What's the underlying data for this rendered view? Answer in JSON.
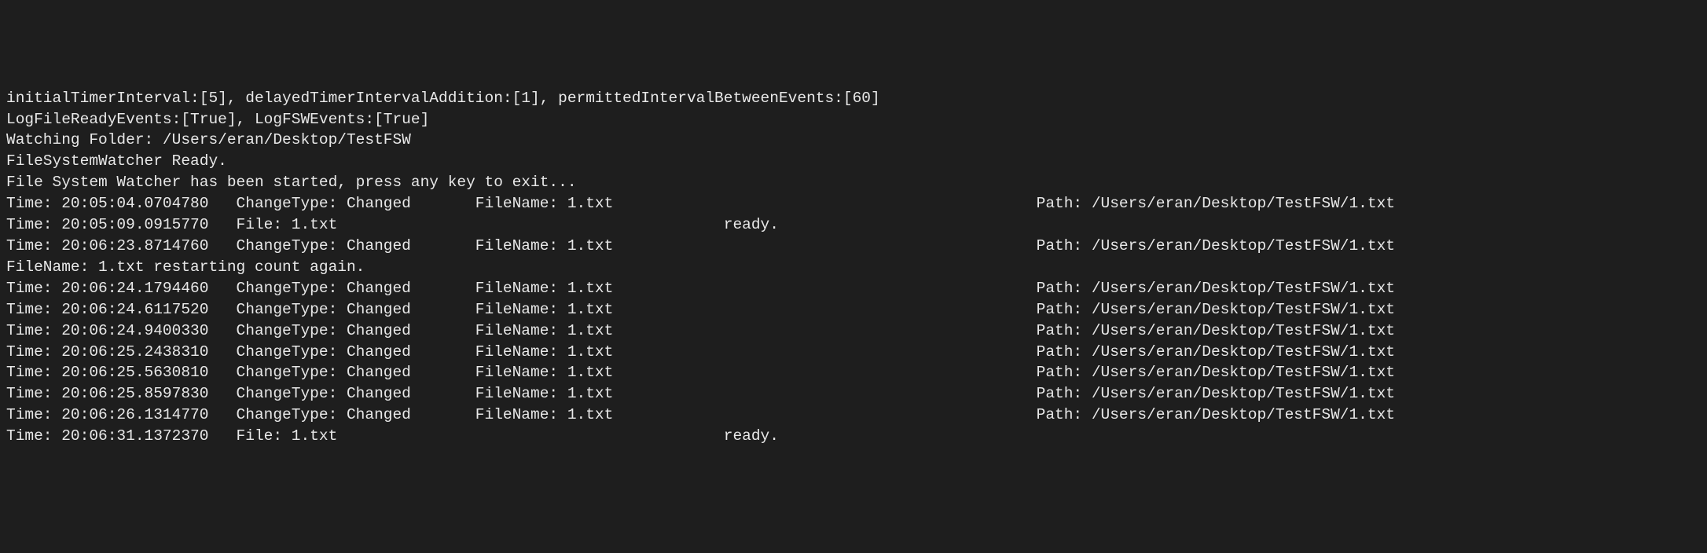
{
  "header": {
    "config_line": "initialTimerInterval:[5], delayedTimerIntervalAddition:[1], permittedIntervalBetweenEvents:[60]",
    "log_config_line": "LogFileReadyEvents:[True], LogFSWEvents:[True]",
    "watching_line": "Watching Folder: /Users/eran/Desktop/TestFSW",
    "ready_line": "FileSystemWatcher Ready.",
    "started_line": "File System Watcher has been started, press any key to exit..."
  },
  "events": [
    "Time: 20:05:04.0704780   ChangeType: Changed       FileName: 1.txt                                              Path: /Users/eran/Desktop/TestFSW/1.txt",
    "Time: 20:05:09.0915770   File: 1.txt                                          ready.",
    "Time: 20:06:23.8714760   ChangeType: Changed       FileName: 1.txt                                              Path: /Users/eran/Desktop/TestFSW/1.txt",
    "FileName: 1.txt restarting count again.",
    "Time: 20:06:24.1794460   ChangeType: Changed       FileName: 1.txt                                              Path: /Users/eran/Desktop/TestFSW/1.txt",
    "Time: 20:06:24.6117520   ChangeType: Changed       FileName: 1.txt                                              Path: /Users/eran/Desktop/TestFSW/1.txt",
    "Time: 20:06:24.9400330   ChangeType: Changed       FileName: 1.txt                                              Path: /Users/eran/Desktop/TestFSW/1.txt",
    "Time: 20:06:25.2438310   ChangeType: Changed       FileName: 1.txt                                              Path: /Users/eran/Desktop/TestFSW/1.txt",
    "Time: 20:06:25.5630810   ChangeType: Changed       FileName: 1.txt                                              Path: /Users/eran/Desktop/TestFSW/1.txt",
    "Time: 20:06:25.8597830   ChangeType: Changed       FileName: 1.txt                                              Path: /Users/eran/Desktop/TestFSW/1.txt",
    "Time: 20:06:26.1314770   ChangeType: Changed       FileName: 1.txt                                              Path: /Users/eran/Desktop/TestFSW/1.txt",
    "Time: 20:06:31.1372370   File: 1.txt                                          ready."
  ]
}
